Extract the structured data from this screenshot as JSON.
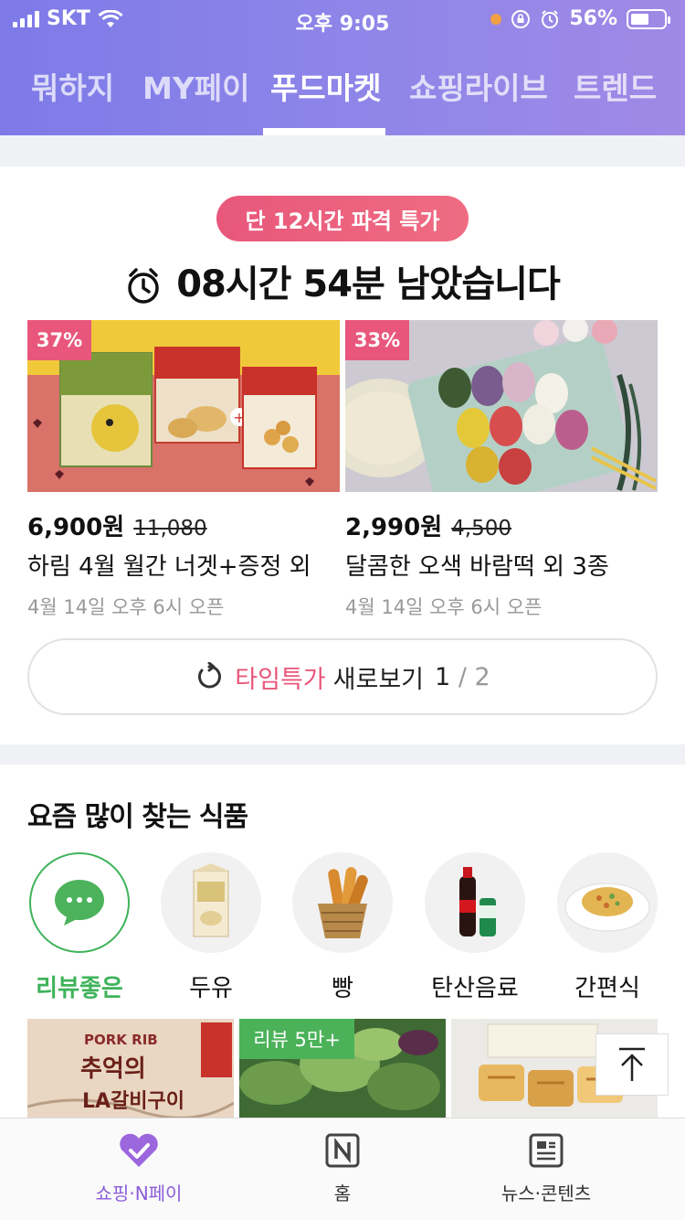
{
  "status_bar": {
    "carrier": "SKT",
    "time": "오후 9:05",
    "battery": "56%",
    "battery_level": 0.56
  },
  "tabs": [
    {
      "label": "뭐하지",
      "active": false
    },
    {
      "label": "MY페이",
      "active": false
    },
    {
      "label": "푸드마켓",
      "active": true
    },
    {
      "label": "쇼핑라이브",
      "active": false
    },
    {
      "label": "트렌드",
      "active": false
    }
  ],
  "deal": {
    "badge": "단 12시간 파격 특가",
    "countdown": "08시간 54분 남았습니다",
    "products": [
      {
        "discount": "37%",
        "price": "6,900원",
        "original_price": "11,080",
        "name": "하림 4월 월간 너겟+증정 외",
        "open_time": "4월 14일 오후 6시 오픈"
      },
      {
        "discount": "33%",
        "price": "2,990원",
        "original_price": "4,500",
        "name": "달콤한 오색 바람떡 외 3종",
        "open_time": "4월 14일 오후 6시 오픈"
      }
    ],
    "refresh": {
      "highlight": "타임특가",
      "label": "새로보기",
      "current": "1",
      "separator": "/",
      "total": "2"
    }
  },
  "popular": {
    "title": "요즘 많이 찾는 식품",
    "categories": [
      {
        "label": "리뷰좋은",
        "active": true
      },
      {
        "label": "두유",
        "active": false
      },
      {
        "label": "빵",
        "active": false
      },
      {
        "label": "탄산음료",
        "active": false
      },
      {
        "label": "간편식",
        "active": false
      }
    ],
    "review_tag": "리뷰 5만+",
    "thumb_text": {
      "line1": "PORK RIB",
      "line2": "추억의",
      "line3": "LA갈비구이"
    }
  },
  "bottom_nav": [
    {
      "label": "쇼핑·N페이",
      "active": true
    },
    {
      "label": "홈",
      "active": false
    },
    {
      "label": "뉴스·콘텐츠",
      "active": false
    }
  ],
  "colors": {
    "header_start": "#7d7ae8",
    "header_end": "#a089e6",
    "accent_pink": "#e8577b",
    "accent_green": "#3fb35a",
    "nav_purple": "#8b5dd8"
  }
}
